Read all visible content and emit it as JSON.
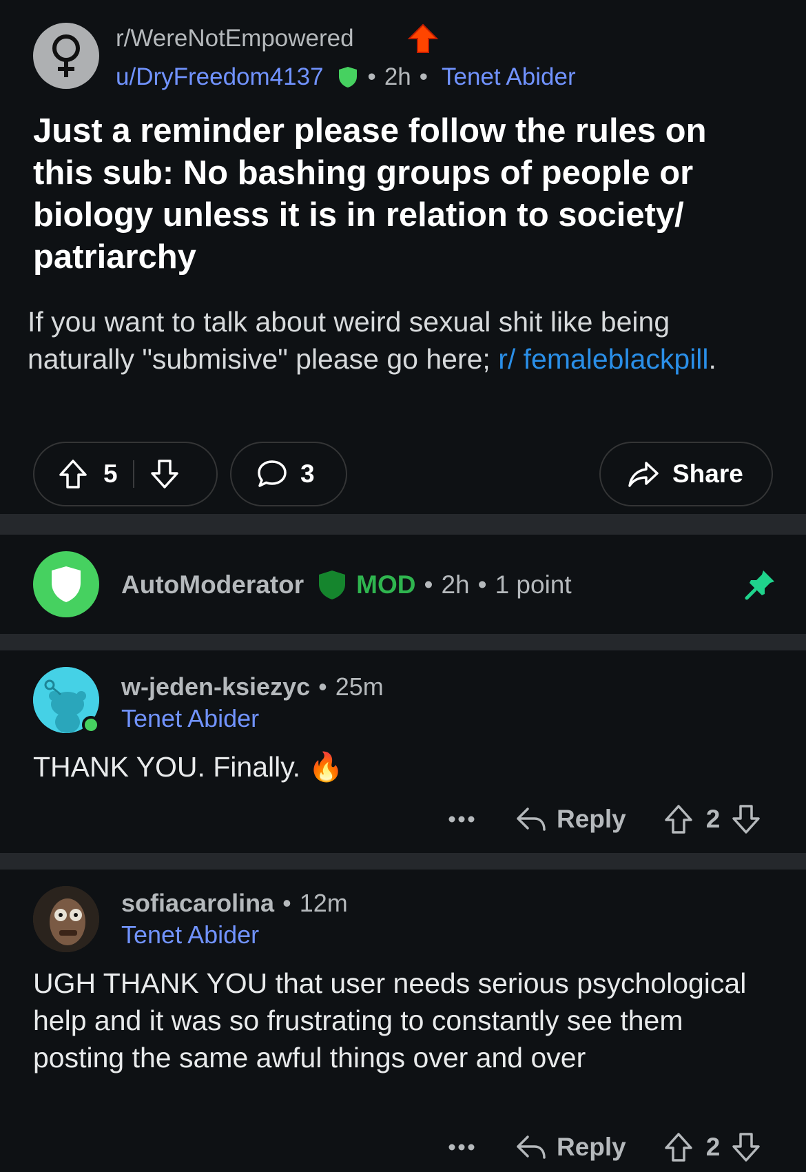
{
  "post": {
    "subreddit": "r/WereNotEmpowered",
    "author": "u/DryFreedom4137",
    "age": "2h",
    "flair": "Tenet Abider",
    "title": "Just a reminder please follow the rules on this sub: No bashing groups of people or biology unless it is in relation to society/ patriarchy",
    "body_text": "If you want to talk about weird sexual shit like being naturally \"submisive\" please go here; ",
    "body_link": "r/ femaleblackpill",
    "body_end": ".",
    "score": "5",
    "comments": "3",
    "share_label": "Share"
  },
  "automod": {
    "author": "AutoModerator",
    "badge": "MOD",
    "age": "2h",
    "points": "1 point"
  },
  "comments": [
    {
      "author": "w-jeden-ksiezyc",
      "age": "25m",
      "flair": "Tenet Abider",
      "body": "THANK YOU. Finally. 🔥",
      "reply_label": "Reply",
      "score": "2"
    },
    {
      "author": "sofiacarolina",
      "age": "12m",
      "flair": "Tenet Abider",
      "body": "UGH THANK YOU that user needs serious psychological help and it was so frustrating to constantly see them posting the same awful things over and over",
      "reply_label": "Reply",
      "score": "2"
    }
  ],
  "colors": {
    "background": "#0e1114",
    "link_blue": "#7193ff",
    "mod_green": "#2fb54f",
    "pin_green": "#1fd38c"
  },
  "icons": [
    "venus-icon",
    "upvote-award-icon",
    "shield-icon",
    "upvote-icon",
    "downvote-icon",
    "comment-icon",
    "share-icon",
    "pin-icon",
    "more-icon",
    "reply-icon"
  ]
}
